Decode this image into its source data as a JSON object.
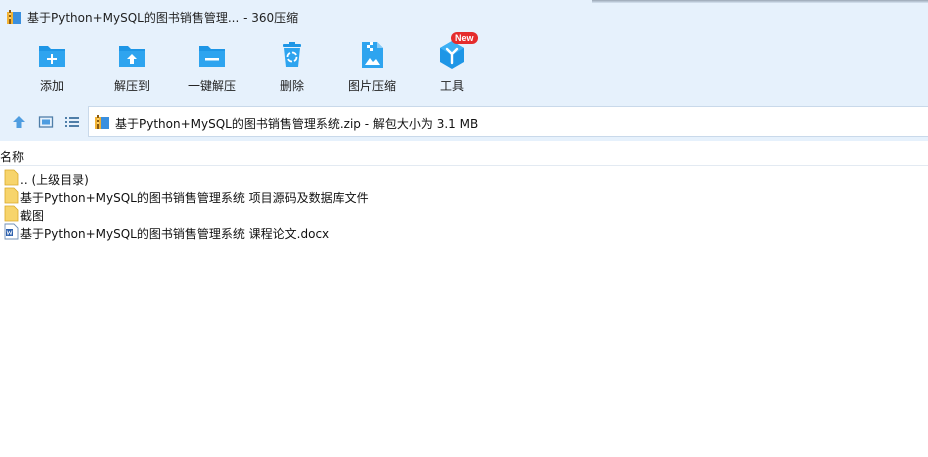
{
  "window": {
    "title": "基于Python+MySQL的图书销售管理... - 360压缩",
    "icon": "archive-icon"
  },
  "toolbar": {
    "items": [
      {
        "label": "添加",
        "icon": "add-folder-icon"
      },
      {
        "label": "解压到",
        "icon": "extract-to-icon"
      },
      {
        "label": "一键解压",
        "icon": "one-click-extract-icon"
      },
      {
        "label": "删除",
        "icon": "delete-bin-icon"
      },
      {
        "label": "图片压缩",
        "icon": "image-compress-icon"
      },
      {
        "label": "工具",
        "icon": "tools-icon",
        "badge": "New"
      }
    ]
  },
  "navigation": {
    "buttons": [
      "up-icon",
      "view-toggle-icon",
      "list-view-icon"
    ],
    "address": "基于Python+MySQL的图书销售管理系统.zip - 解包大小为 3.1 MB"
  },
  "file_list": {
    "column_header": "名称",
    "rows": [
      {
        "name": ".. (上级目录)",
        "icon": "folder-icon"
      },
      {
        "name": "基于Python+MySQL的图书销售管理系统 项目源码及数据库文件",
        "icon": "folder-icon"
      },
      {
        "name": "截图",
        "icon": "folder-icon"
      },
      {
        "name": "基于Python+MySQL的图书销售管理系统 课程论文.docx",
        "icon": "word-doc-icon"
      }
    ]
  },
  "colors": {
    "toolbar_bg": "#e6f1fc",
    "icon_blue": "#1e96e6",
    "badge_red": "#e52c2c",
    "folder_yellow": "#f7d46b"
  }
}
